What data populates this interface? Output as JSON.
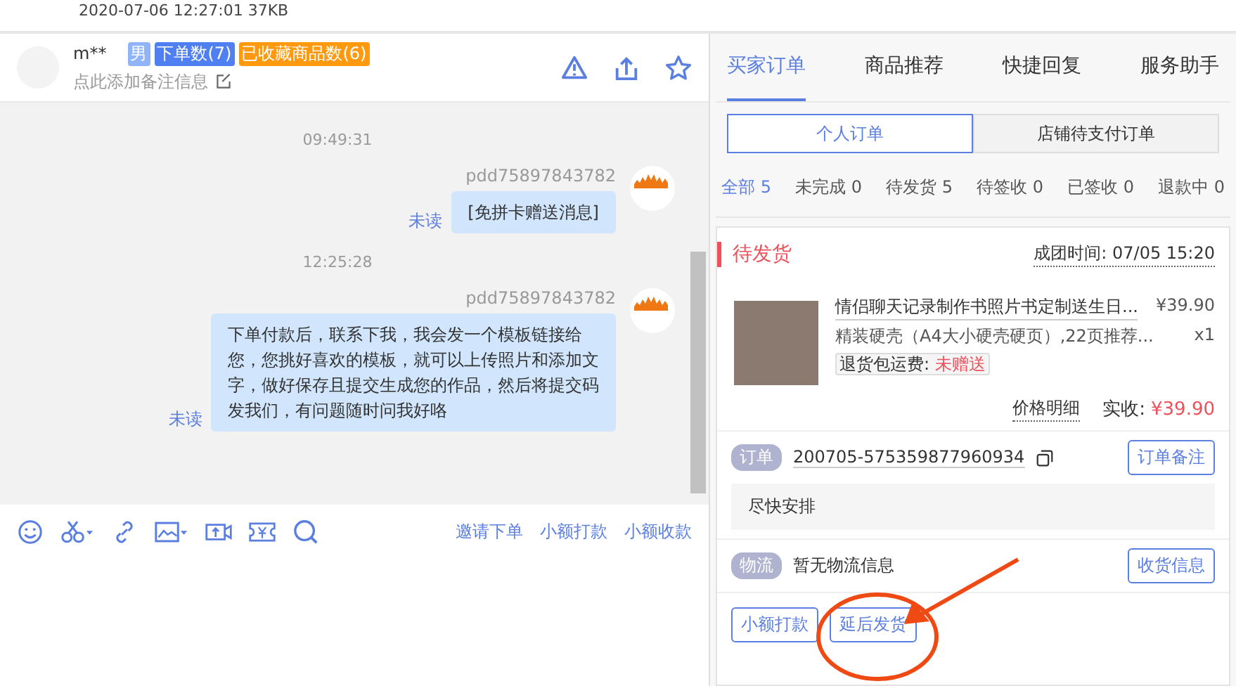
{
  "file_info": "2020-07-06 12:27:01 37KB",
  "chat": {
    "contact": {
      "name": "m**",
      "tags": [
        {
          "text": "男",
          "color": "#8fb4f7"
        },
        {
          "text": "下单数(7)",
          "color": "#4f7ff0"
        },
        {
          "text": "已收藏商品数(6)",
          "color": "#ff9a0f"
        }
      ],
      "remark_link": "点此添加备注信息"
    },
    "messages": [
      {
        "kind": "time",
        "text": "09:49:31"
      },
      {
        "kind": "message",
        "sender": "pdd75897843782",
        "text": "[免拼卡赠送消息]",
        "status": "未读"
      },
      {
        "kind": "time",
        "text": "12:25:28"
      },
      {
        "kind": "message",
        "sender": "pdd75897843782",
        "text": "下单付款后，联系下我，我会发一个模板链接给您，您挑好喜欢的模板，就可以上传照片和添加文字，做好保存且提交生成您的作品，然后将提交码发我们，有问题随时问我好咯",
        "status": "未读"
      }
    ],
    "toolbar_links": [
      "邀请下单",
      "小额打款",
      "小额收款"
    ]
  },
  "sidebar": {
    "tabs": [
      {
        "label": "买家订单",
        "selected": true
      },
      {
        "label": "商品推荐",
        "selected": false
      },
      {
        "label": "快捷回复",
        "selected": false
      },
      {
        "label": "服务助手",
        "selected": false
      }
    ],
    "order_types": [
      {
        "label": "个人订单",
        "selected": true
      },
      {
        "label": "店铺待支付订单",
        "selected": false
      }
    ],
    "filters": [
      {
        "label": "全部 5",
        "selected": true
      },
      {
        "label": "未完成 0",
        "selected": false
      },
      {
        "label": "待发货 5",
        "selected": false
      },
      {
        "label": "待签收 0",
        "selected": false
      },
      {
        "label": "已签收 0",
        "selected": false
      },
      {
        "label": "退款中 0",
        "selected": false
      }
    ],
    "order": {
      "status": "待发货",
      "group_time": "成团时间: 07/05 15:20",
      "product_title": "情侣聊天记录制作书照片书定制送生日...",
      "price": "¥39.90",
      "variant": "精装硬壳（A4大小硬壳硬页）,22页推荐...",
      "quantity": "x1",
      "freight_label": "退货包运费:",
      "freight_value": "未赠送",
      "price_detail": "价格明细",
      "paid_label": "实收:",
      "paid_value": "¥39.90",
      "order_tag": "订单",
      "order_number": "200705-575359877960934",
      "order_note_button": "订单备注",
      "note": "尽快安排",
      "logistics_tag": "物流",
      "logistics": "暂无物流信息",
      "address_button": "收货信息",
      "actions": [
        "小额打款",
        "延后发货"
      ]
    }
  }
}
